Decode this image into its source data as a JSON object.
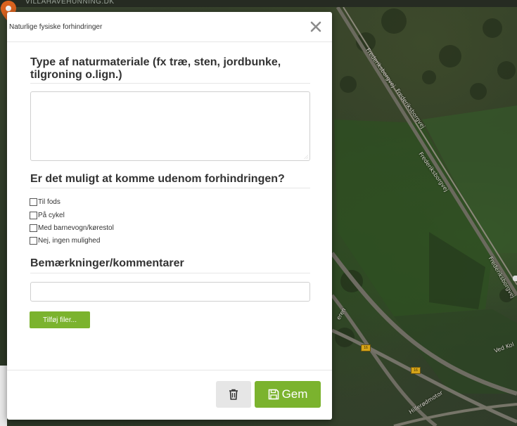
{
  "map": {
    "topbar_text": "VILLAHAVEHUNNING.DK",
    "street_labels": [
      "Frederiksborgvej",
      "Frederiksborgvej",
      "Frederiksborgvej",
      "Frederiksborgvej",
      "Ved Kol",
      "Hillerødmotor",
      "eren"
    ],
    "road_shields": [
      "16",
      "16"
    ],
    "pin_color": "#d9621e"
  },
  "modal": {
    "title": "Naturlige fysiske forhindringer",
    "close_symbol": "✕",
    "section1": {
      "heading": "Type af naturmateriale (fx træ, sten, jordbunke, tilgroning o.lign.)",
      "textarea_value": ""
    },
    "section2": {
      "heading": "Er det muligt at komme udenom forhindringen?",
      "options": [
        {
          "label": "Til fods",
          "checked": false
        },
        {
          "label": "På cykel",
          "checked": false
        },
        {
          "label": "Med barnevogn/kørestol",
          "checked": false
        },
        {
          "label": "Nej, ingen mulighed",
          "checked": false
        }
      ]
    },
    "section3": {
      "heading": "Bemærkninger/kommentarer",
      "input_value": ""
    },
    "add_files_label": "Tilføj filer...",
    "footer": {
      "delete_icon": "trash-icon",
      "save_label": "Gem",
      "save_icon": "floppy-disk-icon"
    },
    "accent_color": "#7bb32e"
  }
}
